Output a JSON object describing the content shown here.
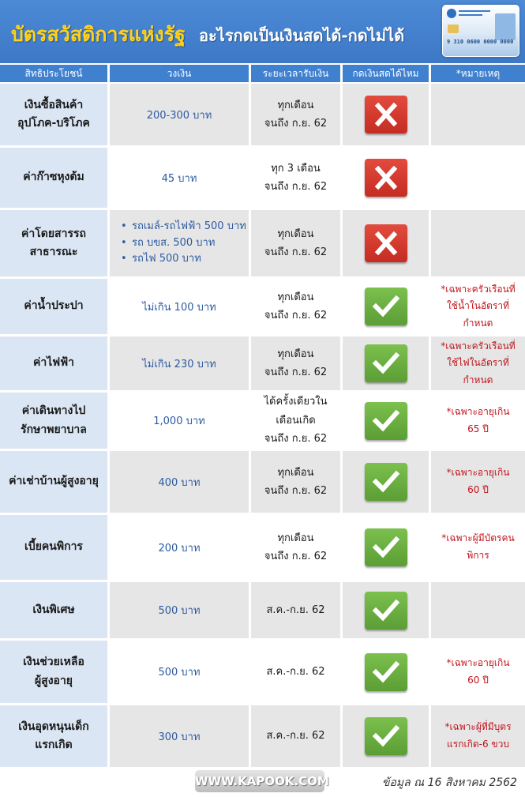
{
  "header": {
    "title_main": "บัตรสวัสดิการแห่งรัฐ",
    "title_sub": "อะไรกดเป็นเงินสดได้-กดไม่ได้",
    "card_number": "9 310 0600 0000 0000"
  },
  "columns": {
    "benefit": "สิทธิประโยชน์",
    "amount": "วงเงิน",
    "period": "ระยะเวลารับเงิน",
    "cash": "กดเงินสดได้ไหม",
    "note": "*หมายเหตุ"
  },
  "rows": [
    {
      "benefit": [
        "เงินซื้อสินค้า",
        "อุปโภค-บริโภค"
      ],
      "amount": "200-300 บาท",
      "period": [
        "ทุกเดือน",
        "จนถึง ก.ย. 62"
      ],
      "cash": "no",
      "note": []
    },
    {
      "benefit": [
        "ค่าก๊าซหุงต้ม"
      ],
      "amount": "45 บาท",
      "period": [
        "ทุก 3 เดือน",
        "จนถึง ก.ย. 62"
      ],
      "cash": "no",
      "note": []
    },
    {
      "benefit": [
        "ค่าโดยสารรถ",
        "สาธารณะ"
      ],
      "amount_list": [
        "รถเมล์-รถไฟฟ้า 500 บาท",
        "รถ บขส. 500 บาท",
        "รถไฟ 500 บาท"
      ],
      "period": [
        "ทุกเดือน",
        "จนถึง ก.ย. 62"
      ],
      "cash": "no",
      "note": []
    },
    {
      "benefit": [
        "ค่าน้ำประปา"
      ],
      "amount": "ไม่เกิน 100 บาท",
      "period": [
        "ทุกเดือน",
        "จนถึง ก.ย. 62"
      ],
      "cash": "yes",
      "note": [
        "*เฉพาะครัวเรือนที่",
        "ใช้น้ำในอัตราที่",
        "กำหนด"
      ]
    },
    {
      "benefit": [
        "ค่าไฟฟ้า"
      ],
      "amount": "ไม่เกิน 230 บาท",
      "period": [
        "ทุกเดือน",
        "จนถึง ก.ย. 62"
      ],
      "cash": "yes",
      "note": [
        "*เฉพาะครัวเรือนที่",
        "ใช้ไฟในอัตราที่",
        "กำหนด"
      ]
    },
    {
      "benefit": [
        "ค่าเดินทางไป",
        "รักษาพยาบาล"
      ],
      "amount": "1,000 บาท",
      "period": [
        "ได้ครั้งเดียวใน",
        "เดือนเกิด",
        "จนถึง ก.ย. 62"
      ],
      "cash": "yes",
      "note": [
        "*เฉพาะอายุเกิน",
        "65 ปี"
      ]
    },
    {
      "benefit": [
        "ค่าเช่าบ้านผู้สูงอายุ"
      ],
      "amount": "400 บาท",
      "period": [
        "ทุกเดือน",
        "จนถึง ก.ย. 62"
      ],
      "cash": "yes",
      "note": [
        "*เฉพาะอายุเกิน",
        "60 ปี"
      ]
    },
    {
      "benefit": [
        "เบี้ยคนพิการ"
      ],
      "amount": "200 บาท",
      "period": [
        "ทุกเดือน",
        "จนถึง ก.ย. 62"
      ],
      "cash": "yes",
      "note": [
        "*เฉพาะผู้มีบัตรคน",
        "พิการ"
      ]
    },
    {
      "benefit": [
        "เงินพิเศษ"
      ],
      "amount": "500 บาท",
      "period": [
        "ส.ค.-ก.ย. 62"
      ],
      "cash": "yes",
      "note": []
    },
    {
      "benefit": [
        "เงินช่วยเหลือ",
        "ผู้สูงอายุ"
      ],
      "amount": "500 บาท",
      "period": [
        "ส.ค.-ก.ย. 62"
      ],
      "cash": "yes",
      "note": [
        "*เฉพาะอายุเกิน",
        "60 ปี"
      ]
    },
    {
      "benefit": [
        "เงินอุดหนุนเด็ก",
        "แรกเกิด"
      ],
      "amount": "300 บาท",
      "period": [
        "ส.ค.-ก.ย. 62"
      ],
      "cash": "yes",
      "note": [
        "*เฉพาะผู้ที่มีบุตร",
        "แรกเกิด-6 ขวบ"
      ]
    }
  ],
  "icons": {
    "no": "x-mark-icon",
    "yes": "check-mark-icon"
  },
  "colors": {
    "header_bg": "#3d78c6",
    "title_yellow": "#ffd21a",
    "no_red": "#d63a2e",
    "yes_green": "#6bb043",
    "note_red": "#c0151d"
  },
  "footer": {
    "logo": "WWW.KAPOOK.COM",
    "date": "ข้อมูล ณ 16 สิงหาคม 2562"
  }
}
